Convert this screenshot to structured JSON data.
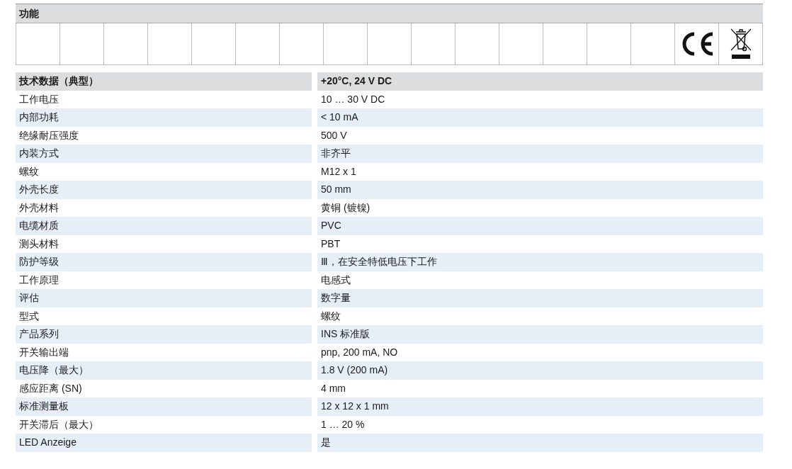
{
  "function_panel": {
    "title": "功能",
    "cells": [
      {
        "kind": "blank"
      },
      {
        "kind": "blank"
      },
      {
        "kind": "blank"
      },
      {
        "kind": "blank"
      },
      {
        "kind": "blank"
      },
      {
        "kind": "blank"
      },
      {
        "kind": "blank"
      },
      {
        "kind": "blank"
      },
      {
        "kind": "blank"
      },
      {
        "kind": "blank"
      },
      {
        "kind": "blank"
      },
      {
        "kind": "blank"
      },
      {
        "kind": "blank"
      },
      {
        "kind": "blank"
      },
      {
        "kind": "blank"
      },
      {
        "kind": "ce-mark"
      },
      {
        "kind": "weee-mark"
      }
    ]
  },
  "spec_table": {
    "header": [
      "技术数据（典型）",
      "+20°C, 24 V DC"
    ],
    "rows": [
      {
        "label": "工作电压",
        "value": "10 … 30 V DC"
      },
      {
        "label": "内部功耗",
        "value": "< 10 mA"
      },
      {
        "label": "绝缘耐压强度",
        "value": "500 V"
      },
      {
        "label": "内装方式",
        "value": "非齐平"
      },
      {
        "label": "螺纹",
        "value": "M12 x 1"
      },
      {
        "label": "外壳长度",
        "value": "50 mm"
      },
      {
        "label": "外壳材料",
        "value": "黄铜 (镀镍)"
      },
      {
        "label": "电缆材质",
        "value": "PVC"
      },
      {
        "label": "测头材料",
        "value": "PBT"
      },
      {
        "label": "防护等级",
        "value": "Ⅲ，在安全特低电压下工作"
      },
      {
        "label": "工作原理",
        "value": "电感式"
      },
      {
        "label": "评估",
        "value": "数字量"
      },
      {
        "label": "型式",
        "value": "螺纹"
      },
      {
        "label": "产品系列",
        "value": "INS 标准版"
      },
      {
        "label": "开关输出端",
        "value": "pnp, 200 mA, NO"
      },
      {
        "label": "电压降（最大）",
        "value": "1.8 V (200 mA)"
      },
      {
        "label": "感应距离 (SN)",
        "value": "4 mm"
      },
      {
        "label": "标准测量板",
        "value": "12 x 12 x 1 mm"
      },
      {
        "label": "开关滞后（最大）",
        "value": "1 … 20 %"
      },
      {
        "label": "LED Anzeige",
        "value": "是"
      }
    ]
  }
}
